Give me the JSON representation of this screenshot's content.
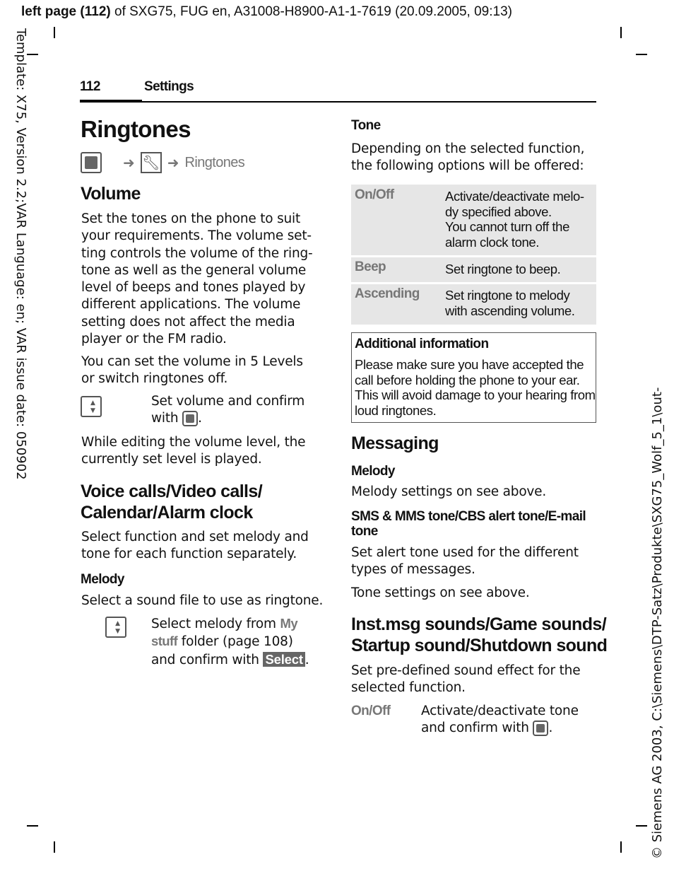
{
  "header": {
    "bold": "left page (112)",
    "rest": " of SXG75, FUG en, A31008-H8900-A1-1-7619 (20.09.2005, 09:13)"
  },
  "side_left": "Template: X75, Version 2.2;VAR Language: en; VAR issue date: 050902",
  "side_right": "© Siemens AG 2003, C:\\Siemens\\DTP-Satz\\Produkte\\SXG75_Wolf_5_1\\out-",
  "running": {
    "page": "112",
    "section": "Settings"
  },
  "title": "Ringtones",
  "nav_path": {
    "arrow": "➜",
    "item": "Ringtones",
    "icons": [
      "menu-key-icon",
      "settings-wrench-icon"
    ]
  },
  "left": {
    "volume_h": "Volume",
    "volume_p1": "Set the tones on the phone to suit\nyour requirements. The volume set-\nting controls the volume of the ring-\ntone as well as the general volume\nlevel of beeps and tones played by\ndifferent applications. The volume\nsetting does not affect the media\nplayer or the FM radio.",
    "volume_p2": "You can set the volume in 5 Levels\nor switch ringtones off.",
    "volume_step": "Set volume and confirm\nwith",
    "volume_p3": "While editing the volume level, the\ncurrently set level is played.",
    "voice_h": "Voice calls/Video calls/\nCalendar/Alarm clock",
    "voice_p": "Select function and set melody and\ntone for each function separately.",
    "melody_h": "Melody",
    "melody_p": "Select a sound file to use as ringtone.",
    "melody_step_a": "Select melody from ",
    "melody_step_my": "My",
    "melody_step_stuff": "stuff",
    "melody_step_b": " folder (page 108)",
    "melody_step_c": "and confirm with ",
    "select_key": "Select"
  },
  "right": {
    "tone_h": "Tone",
    "tone_p": "Depending on the selected function,\nthe following options will be offered:",
    "tone_table": [
      {
        "option": "On/Off",
        "desc": "Activate/deactivate melo-\ndy specified above.\nYou cannot turn off the\nalarm clock tone."
      },
      {
        "option": "Beep",
        "desc": "Set ringtone to beep."
      },
      {
        "option": "Ascending",
        "desc": "Set ringtone to melody\nwith ascending volume."
      }
    ],
    "info_h": "Additional information",
    "info_p": "Please make sure you have accepted the\ncall before holding the phone to your ear.\nThis will avoid damage to your hearing from\nloud ringtones.",
    "messaging_h": "Messaging",
    "msg_melody_h": "Melody",
    "msg_melody_p": "Melody settings on see above.",
    "sms_h": "SMS & MMS tone/CBS alert tone/E-mail\ntone",
    "sms_p": "Set alert tone used for the different\ntypes of messages.",
    "sms_p2": "Tone settings on see above.",
    "inst_h": "Inst.msg sounds/Game sounds/\nStartup sound/Shutdown sound",
    "inst_p": "Set pre-defined sound effect for the\nselected function.",
    "onoff": "On/Off",
    "onoff_desc": "Activate/deactivate tone\nand confirm with"
  }
}
